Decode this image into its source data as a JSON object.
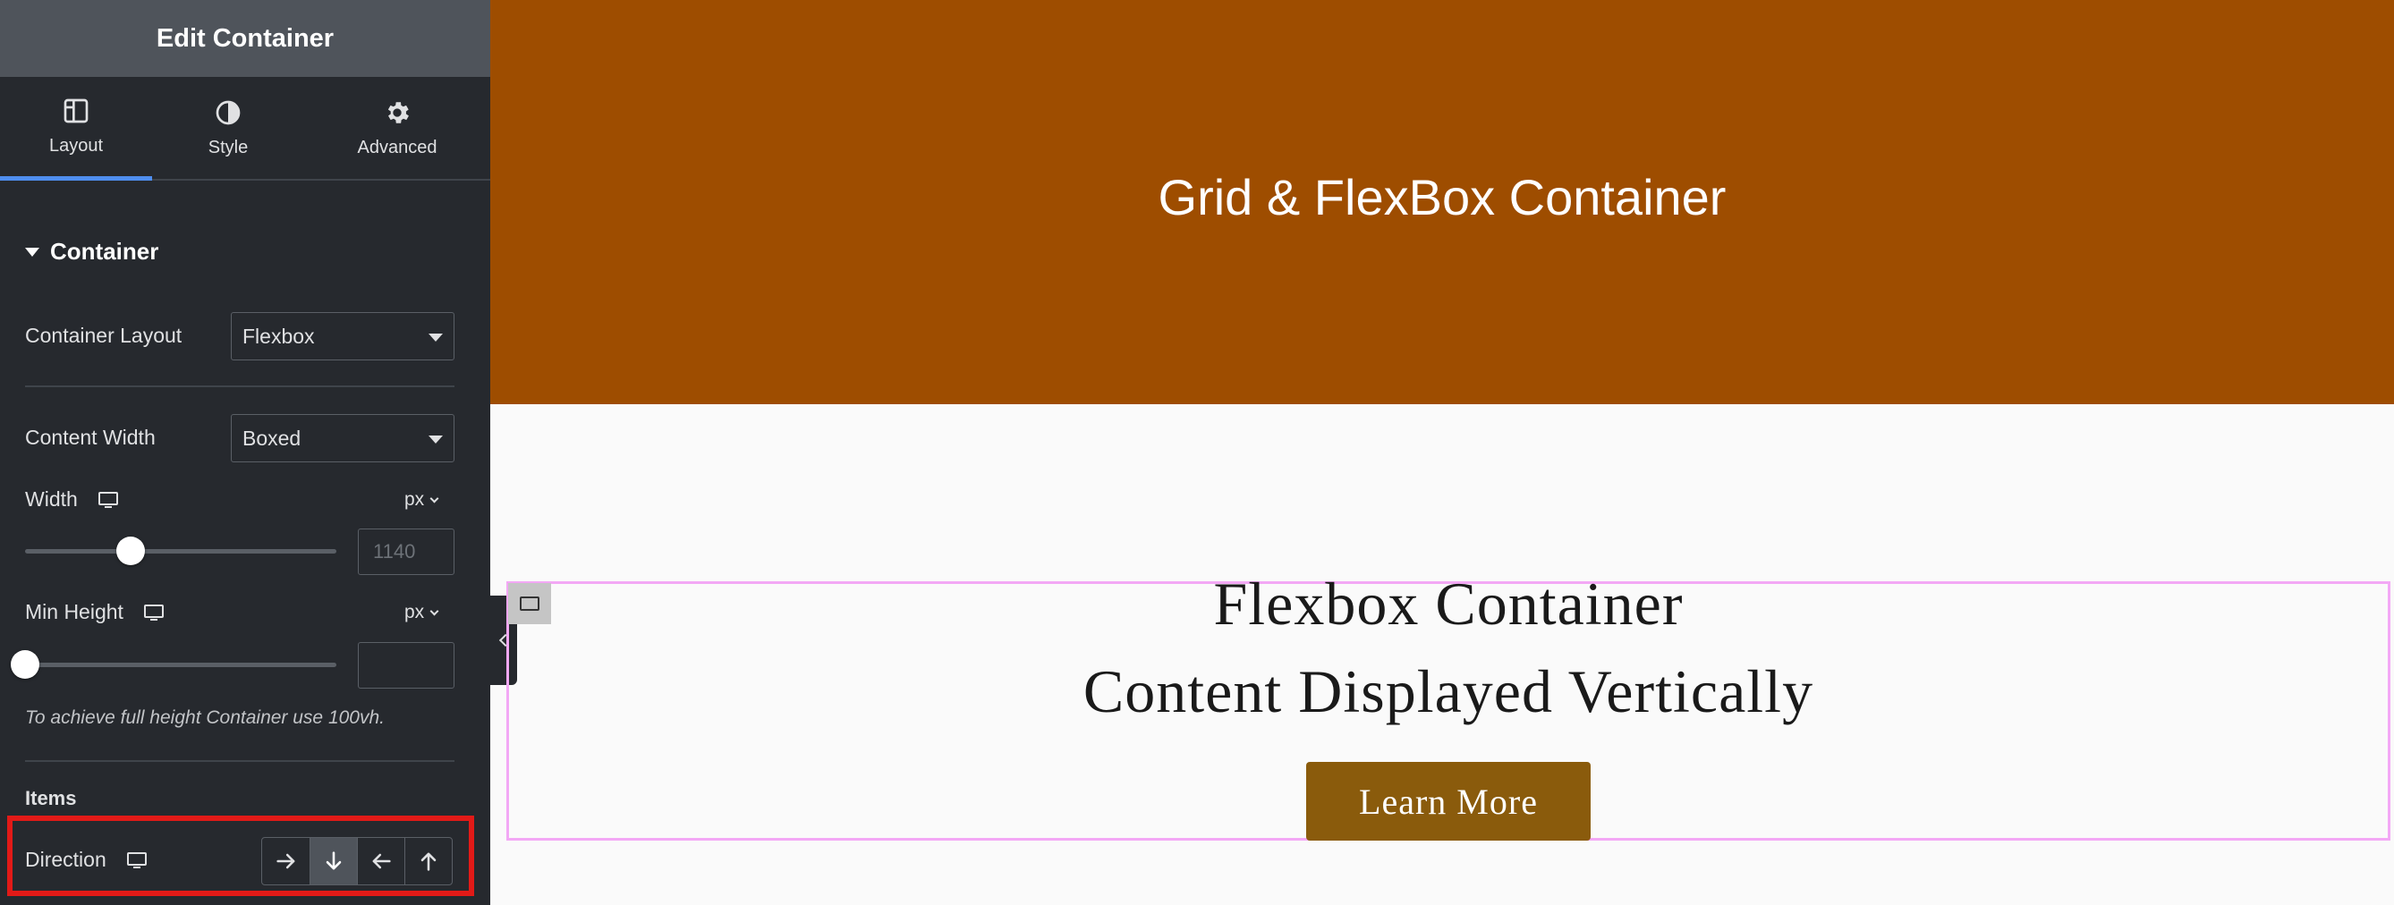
{
  "panel": {
    "title": "Edit Container",
    "tabs": [
      {
        "label": "Layout",
        "icon": "layout-columns-icon",
        "active": true
      },
      {
        "label": "Style",
        "icon": "half-circle-contrast-icon",
        "active": false
      },
      {
        "label": "Advanced",
        "icon": "gear-icon",
        "active": false
      }
    ],
    "section": {
      "title": "Container"
    },
    "container_layout": {
      "label": "Container Layout",
      "value": "Flexbox"
    },
    "content_width": {
      "label": "Content Width",
      "value": "Boxed"
    },
    "width": {
      "label": "Width",
      "unit": "px",
      "value": "",
      "placeholder": "1140",
      "slider_fraction": 0.34
    },
    "min_height": {
      "label": "Min Height",
      "unit": "px",
      "value": "",
      "placeholder": "",
      "slider_fraction": 0.0
    },
    "hint": "To achieve full height Container use 100vh.",
    "items_heading": "Items",
    "direction": {
      "label": "Direction",
      "options": [
        {
          "icon": "arrow-right-icon",
          "active": false
        },
        {
          "icon": "arrow-down-icon",
          "active": true
        },
        {
          "icon": "arrow-left-icon",
          "active": false
        },
        {
          "icon": "arrow-up-icon",
          "active": false
        }
      ]
    }
  },
  "canvas": {
    "hero_title": "Grid & FlexBox Container",
    "hero_color": "#9e4d00",
    "heading_line1": "Flexbox Container",
    "heading_line2": "Content Displayed Vertically",
    "button_label": "Learn More",
    "button_color": "#8a5b0c"
  },
  "colors": {
    "panel_bg": "#26292e",
    "accent": "#4f8eef",
    "highlight": "#e21a17",
    "container_outline": "#f3a8f5"
  }
}
